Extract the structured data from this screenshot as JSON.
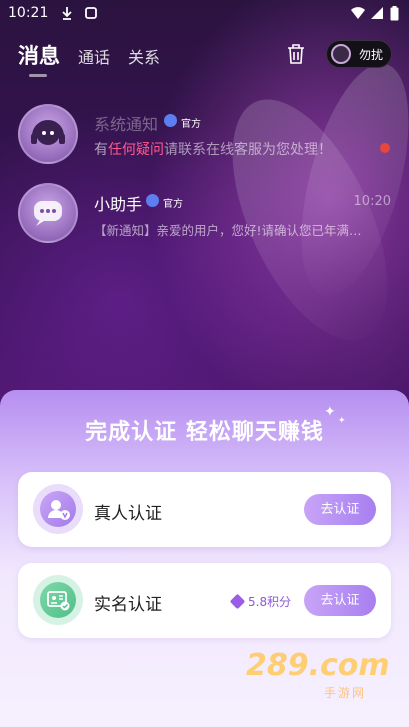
{
  "status_bar": {
    "time": "10:21"
  },
  "nav": {
    "tabs": [
      {
        "label": "消息",
        "active": true
      },
      {
        "label": "通话",
        "active": false
      },
      {
        "label": "关系",
        "active": false
      }
    ],
    "dnd_label": "勿扰"
  },
  "chats": [
    {
      "name": "系统通知",
      "badge": "官方",
      "message_prefix": "有",
      "message_highlight": "任何疑问",
      "message_suffix": "请联系在线客服为您处理！",
      "time": "",
      "unread": true
    },
    {
      "name": "小助手",
      "badge": "官方",
      "message": "【新通知】亲爱的用户，您好!请确认您已年满…",
      "time": "10:20",
      "unread": true
    }
  ],
  "sheet": {
    "title": "完成认证  轻松聊天赚钱",
    "cards": [
      {
        "label": "真人认证",
        "button": "去认证",
        "reward": ""
      },
      {
        "label": "实名认证",
        "button": "去认证",
        "reward": "5.8积分"
      }
    ]
  },
  "watermark": {
    "text": "289.com",
    "sub": "手游网"
  },
  "colors": {
    "accent": "#a77ff0",
    "highlight": "#ff5a8e",
    "unread": "#e8453c"
  }
}
